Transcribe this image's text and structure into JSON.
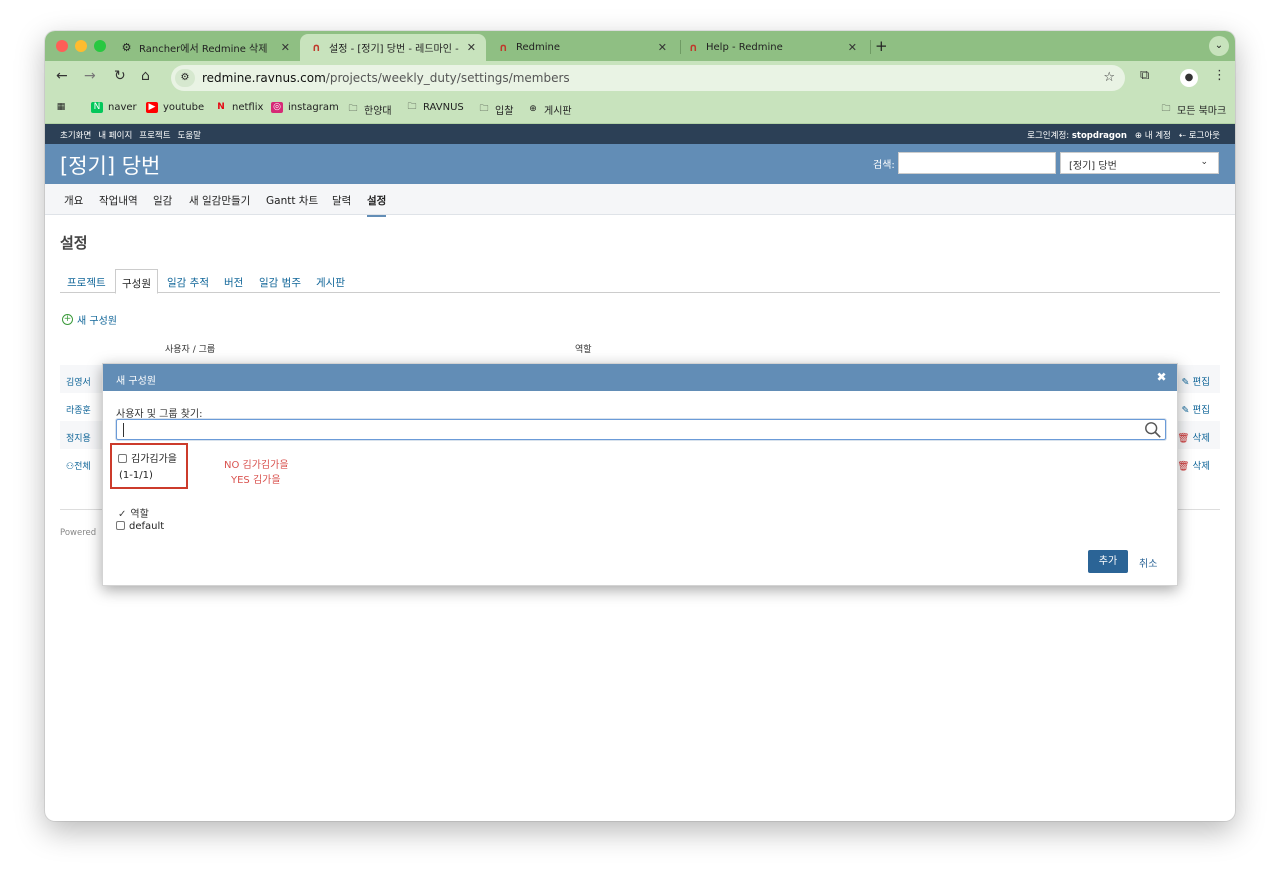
{
  "browser": {
    "tabs": [
      {
        "title": "Rancher에서 Redmine 삭제",
        "icon": "⚙"
      },
      {
        "title": "설정 - [정기] 당번 - 레드마인 - 전",
        "icon": "∩"
      },
      {
        "title": "Redmine",
        "icon": "∩"
      },
      {
        "title": "Help - Redmine",
        "icon": "∩"
      }
    ],
    "url_host": "redmine.ravnus.com",
    "url_path": "/projects/weekly_duty/settings/members",
    "bookmarks": [
      "naver",
      "youtube",
      "netflix",
      "instagram",
      "한양대",
      "RAVNUS",
      "입찰",
      "게시판"
    ],
    "all_bookmarks": "모든 북마크"
  },
  "topmenu": {
    "left": [
      "초기화면",
      "내 페이지",
      "프로젝트",
      "도움말"
    ],
    "login_label": "로그인계정:",
    "login_user": "stopdragon",
    "my_account": "내 계정",
    "logout": "로그아웃"
  },
  "header": {
    "title": "[정기] 당번",
    "search_label": "검색:",
    "project_select": "[정기] 당번"
  },
  "mainmenu": [
    "개요",
    "작업내역",
    "일감",
    "새 일감만들기",
    "Gantt 차트",
    "달력",
    "설정"
  ],
  "page": {
    "title": "설정",
    "tabs": [
      "프로젝트",
      "구성원",
      "일감 추적",
      "버전",
      "일감 범주",
      "게시판"
    ],
    "new_member": "새 구성원",
    "col_user": "사용자 / 그룹",
    "col_role": "역할",
    "rows": [
      {
        "name": "김영서",
        "action": "편집"
      },
      {
        "name": "라종훈",
        "action": "편집"
      },
      {
        "name": "정지용",
        "action": "삭제"
      },
      {
        "name": "전체",
        "action": "삭제"
      }
    ],
    "powered": "Powered"
  },
  "modal": {
    "title": "새 구성원",
    "search_label": "사용자 및 그룹 찾기:",
    "candidate": "김가김가을",
    "pagination": "(1-1/1)",
    "note_no": "NO 김가김가을",
    "note_yes": "YES 김가을",
    "roles_label": "역할",
    "role_default": "default",
    "add_button": "추가",
    "cancel": "취소"
  }
}
